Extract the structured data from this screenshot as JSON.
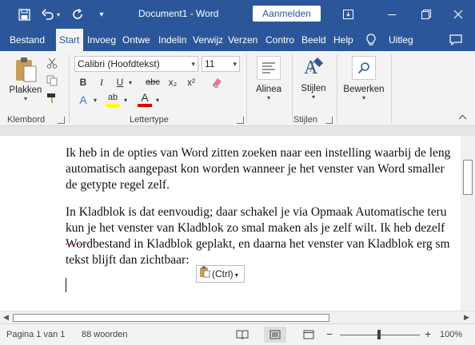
{
  "titlebar": {
    "doc_title": "Document1  -  Word",
    "signin": "Aanmelden",
    "save_icon": "save-icon",
    "undo_icon": "undo-icon",
    "redo_icon": "redo-icon"
  },
  "tabs": [
    "Bestand",
    "Start",
    "Invoeg",
    "Ontwe",
    "Indelin",
    "Verwijz",
    "Verzen",
    "Contro",
    "Beeld",
    "Help"
  ],
  "tellme": "Uitleg",
  "ribbon": {
    "clipboard": {
      "paste": "Plakken",
      "label": "Klembord"
    },
    "font": {
      "name": "Calibri (Hoofdtekst)",
      "size": "11",
      "label": "Lettertype",
      "bold": "B",
      "italic": "I",
      "underline": "U",
      "strike": "abc",
      "subscript": "x₂",
      "superscript": "x²",
      "text_effects": "A",
      "highlight": "ab",
      "font_color": "A"
    },
    "paragraph": {
      "label": "Alinea"
    },
    "styles": {
      "label": "Stijlen"
    },
    "editing": {
      "label": "Bewerken"
    }
  },
  "document": {
    "para1": [
      "Ik heb in de opties van Word zitten zoeken naar een instelling waarbij de leng",
      "automatisch aangepast kon worden wanneer je het venster van Word smaller",
      "de getypte regel zelf."
    ],
    "para2": [
      "In Kladblok is dat eenvoudig; daar schakel je via Opmaak  Automatische teru",
      "kun je het venster van Kladblok zo smal maken als je zelf wilt. Ik heb dezelf",
      "Wordbestand in Kladblok geplakt, en daarna het venster van Kladblok erg sm",
      "tekst blijft dan zichtbaar:"
    ],
    "paste_options": "(Ctrl)"
  },
  "statusbar": {
    "page": "Pagina 1 van 1",
    "words": "88 woorden",
    "zoom": "100%",
    "minus": "−",
    "plus": "+"
  }
}
